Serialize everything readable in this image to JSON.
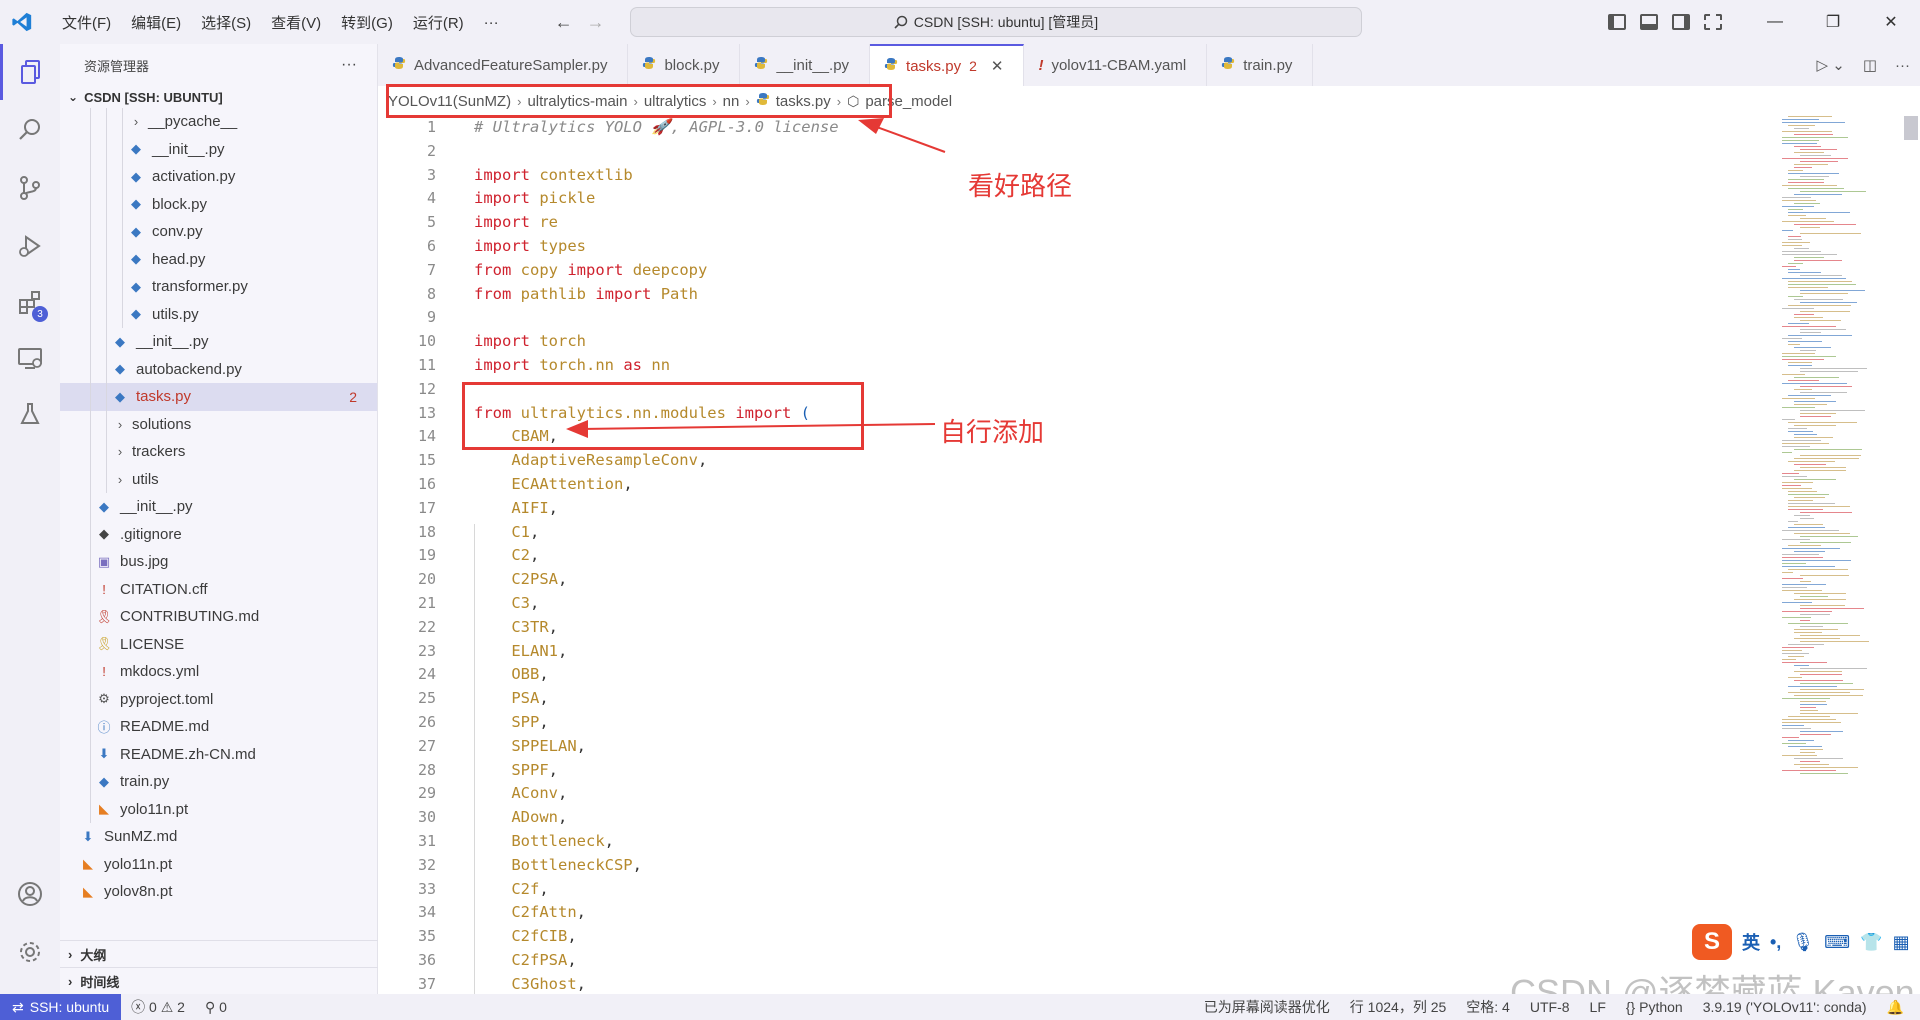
{
  "titlebar": {
    "menus": [
      "文件(F)",
      "编辑(E)",
      "选择(S)",
      "查看(V)",
      "转到(G)",
      "运行(R)",
      "···"
    ],
    "command_center": "CSDN [SSH: ubuntu] [管理员]"
  },
  "activity_badge": "3",
  "sidebar": {
    "title": "资源管理器",
    "more": "···",
    "root": "CSDN [SSH: UBUNTU]",
    "items": [
      {
        "label": "__pycache__",
        "type": "folder",
        "depth": 3
      },
      {
        "label": "__init__.py",
        "type": "py",
        "depth": 3
      },
      {
        "label": "activation.py",
        "type": "py",
        "depth": 3
      },
      {
        "label": "block.py",
        "type": "py",
        "depth": 3
      },
      {
        "label": "conv.py",
        "type": "py",
        "depth": 3
      },
      {
        "label": "head.py",
        "type": "py",
        "depth": 3
      },
      {
        "label": "transformer.py",
        "type": "py",
        "depth": 3
      },
      {
        "label": "utils.py",
        "type": "py",
        "depth": 3
      },
      {
        "label": "__init__.py",
        "type": "py",
        "depth": 2
      },
      {
        "label": "autobackend.py",
        "type": "py",
        "depth": 2
      },
      {
        "label": "tasks.py",
        "type": "py",
        "depth": 2,
        "selected": true,
        "count": "2"
      },
      {
        "label": "solutions",
        "type": "folder",
        "depth": 2
      },
      {
        "label": "trackers",
        "type": "folder",
        "depth": 2
      },
      {
        "label": "utils",
        "type": "folder",
        "depth": 2
      },
      {
        "label": "__init__.py",
        "type": "py",
        "depth": 1
      },
      {
        "label": ".gitignore",
        "type": "git",
        "depth": 1
      },
      {
        "label": "bus.jpg",
        "type": "img",
        "depth": 1
      },
      {
        "label": "CITATION.cff",
        "type": "excl",
        "depth": 1
      },
      {
        "label": "CONTRIBUTING.md",
        "type": "ribbon",
        "depth": 1
      },
      {
        "label": "LICENSE",
        "type": "license",
        "depth": 1
      },
      {
        "label": "mkdocs.yml",
        "type": "excl",
        "depth": 1
      },
      {
        "label": "pyproject.toml",
        "type": "gear",
        "depth": 1
      },
      {
        "label": "README.md",
        "type": "info",
        "depth": 1
      },
      {
        "label": "README.zh-CN.md",
        "type": "md",
        "depth": 1
      },
      {
        "label": "train.py",
        "type": "py",
        "depth": 1
      },
      {
        "label": "yolo11n.pt",
        "type": "rss",
        "depth": 1
      },
      {
        "label": "SunMZ.md",
        "type": "md",
        "depth": 0
      },
      {
        "label": "yolo11n.pt",
        "type": "rss",
        "depth": 0
      },
      {
        "label": "yolov8n.pt",
        "type": "rss",
        "depth": 0
      }
    ],
    "outline": "大纲",
    "timeline": "时间线"
  },
  "tabs": [
    {
      "label": "AdvancedFeatureSampler.py",
      "icon": "py"
    },
    {
      "label": "block.py",
      "icon": "py"
    },
    {
      "label": "__init__.py",
      "icon": "py"
    },
    {
      "label": "tasks.py",
      "icon": "py",
      "active": true,
      "count": "2"
    },
    {
      "label": "yolov11-CBAM.yaml",
      "icon": "excl"
    },
    {
      "label": "train.py",
      "icon": "py"
    }
  ],
  "breadcrumb": [
    "YOLOv11(SunMZ)",
    "ultralytics-main",
    "ultralytics",
    "nn",
    "tasks.py",
    "parse_model"
  ],
  "line_numbers": [
    1,
    2,
    3,
    4,
    5,
    6,
    7,
    8,
    9,
    10,
    11,
    12,
    13,
    14,
    15,
    16,
    17,
    18,
    19,
    20,
    21,
    22,
    23,
    24,
    25,
    26,
    27,
    28,
    29,
    30,
    31,
    32,
    33,
    34,
    35,
    36,
    37
  ],
  "code": {
    "l1": "# Ultralytics YOLO 🚀, AGPL-3.0 license",
    "imports": [
      [
        "import",
        "contextlib"
      ],
      [
        "import",
        "pickle"
      ],
      [
        "import",
        "re"
      ],
      [
        "import",
        "types"
      ]
    ],
    "from_imports": [
      [
        "from",
        "copy",
        "import",
        "deepcopy"
      ],
      [
        "from",
        "pathlib",
        "import",
        "Path"
      ]
    ],
    "torch_import": [
      "import",
      "torch"
    ],
    "torch_nn_import": [
      "import",
      "torch.nn",
      "as",
      "nn"
    ],
    "modules_import": [
      "from",
      "ultralytics.nn.modules",
      "import",
      "("
    ],
    "names": [
      "CBAM",
      "AdaptiveResampleConv",
      "ECAAttention",
      "AIFI",
      "C1",
      "C2",
      "C2PSA",
      "C3",
      "C3TR",
      "ELAN1",
      "OBB",
      "PSA",
      "SPP",
      "SPPELAN",
      "SPPF",
      "AConv",
      "ADown",
      "Bottleneck",
      "BottleneckCSP",
      "C2f",
      "C2fAttn",
      "C2fCIB",
      "C2fPSA",
      "C3Ghost"
    ]
  },
  "annotations": {
    "path_note": "看好路径",
    "add_note": "自行添加"
  },
  "statusbar": {
    "remote": "SSH: ubuntu",
    "errors": "0",
    "warnings": "2",
    "ports": "0",
    "screen_reader": "已为屏幕阅读器优化",
    "position": "行 1024，列 25",
    "spaces": "空格: 4",
    "encoding": "UTF-8",
    "eol": "LF",
    "language": "Python",
    "interpreter": "3.9.19 ('YOLOv11': conda)"
  },
  "ime": {
    "lang": "英",
    "punct": "•,"
  },
  "watermark": "CSDN @逐梦藏蓝 Kaven",
  "colors": {
    "accent": "#5a5ae0",
    "remote": "#4e5fd6",
    "annotation": "#e53935",
    "keyword": "#cf222e",
    "identifier": "#b5892c"
  }
}
